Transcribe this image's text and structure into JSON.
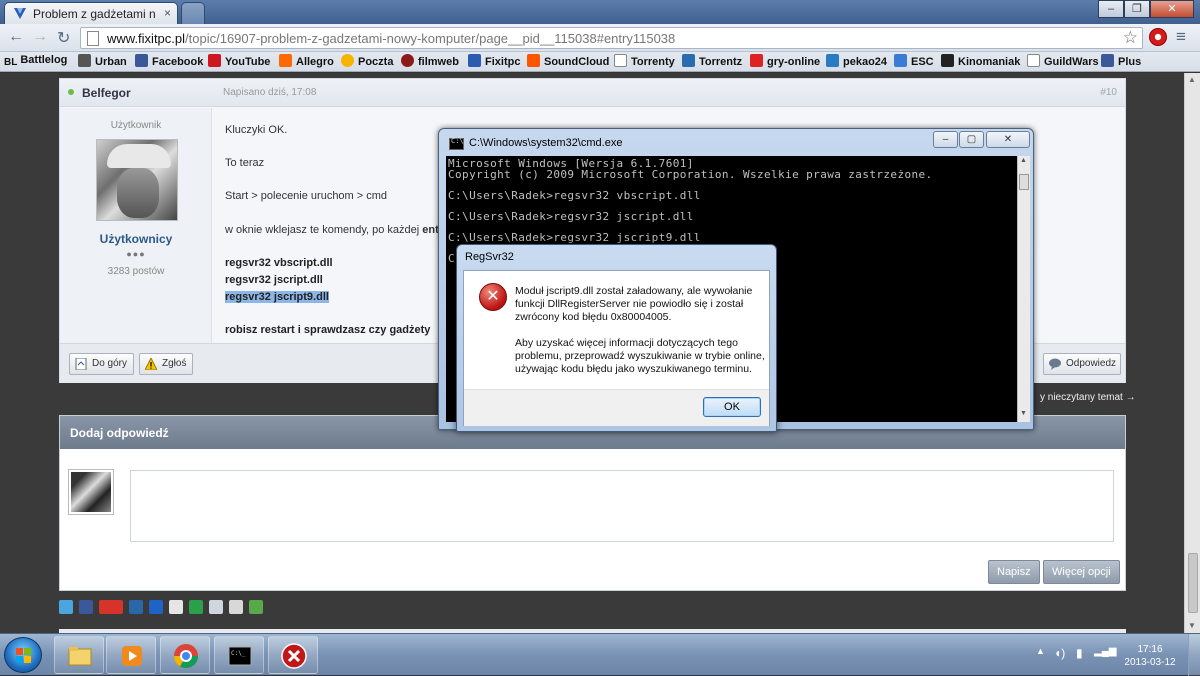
{
  "browser": {
    "tab_title": "Problem z gadżetami nowy komputer",
    "url_host": "www.fixitpc.pl",
    "url_path": "/topic/16907-problem-z-gadzetami-nowy-komputer/page__pid__115038#entry115038",
    "bookmarks": [
      "Battlelog",
      "Urban",
      "Facebook",
      "YouTube",
      "Allegro",
      "Poczta",
      "filmweb",
      "Fixitpc",
      "SoundCloud",
      "Torrenty",
      "Torrentz",
      "gry-online",
      "pekao24",
      "ESC",
      "Kinomaniak",
      "GuildWars",
      "Plus"
    ],
    "bookmark_colors": [
      "#1a1a1a",
      "#3a3a3a",
      "#3b5998",
      "#cc181e",
      "#ff6a00",
      "#f4b400",
      "#8b1a1a",
      "#2a5db0",
      "#ff5500",
      "#ffffff",
      "#2b6cb0",
      "#d22",
      "#2a7bc2",
      "#3a7bd5",
      "#222",
      "#444",
      "#3b5998"
    ]
  },
  "post": {
    "author": "Belfegor",
    "date": "Napisano dziś, 17:08",
    "number": "#10",
    "author_role": "Użytkownik",
    "group": "Użytkownicy",
    "rep": "●●●",
    "post_count": "3283 postów",
    "lines": [
      "Kluczyki OK.",
      "To teraz",
      "Start > polecenie uruchom > cmd",
      "w oknie wklejasz te komendy, po każdej ",
      "ent",
      "regsvr32 vbscript.dll",
      "regsvr32 jscript.dll",
      "regsvr32 jscript9.dll",
      "robisz restart i sprawdzasz czy gadżety"
    ],
    "btn_top": "Do góry",
    "btn_report": "Zgłoś",
    "btn_reply": "Odpowiedz"
  },
  "side_link": "y nieczytany temat →",
  "reply": {
    "title": "Dodaj odpowiedź",
    "btn_post": "Napisz",
    "btn_more": "Więcej opcji"
  },
  "cmd": {
    "title": "C:\\Windows\\system32\\cmd.exe",
    "lines": [
      "Microsoft Windows [Wersja 6.1.7601]",
      "Copyright (c) 2009 Microsoft Corporation. Wszelkie prawa zastrzeżone.",
      "",
      "C:\\Users\\Radek>regsvr32 vbscript.dll",
      "",
      "C:\\Users\\Radek>regsvr32 jscript.dll",
      "",
      "C:\\Users\\Radek>regsvr32 jscript9.dll",
      "",
      "C"
    ]
  },
  "dialog": {
    "title": "RegSvr32",
    "message_1": "Moduł jscript9.dll został załadowany, ale wywołanie funkcji DllRegisterServer nie powiodło się i został zwrócony kod błędu 0x80004005.",
    "message_2": "Aby uzyskać więcej informacji dotyczących tego problemu, przeprowadź wyszukiwanie w trybie online, używając kodu błędu jako wyszukiwanego terminu.",
    "ok_label": "OK"
  },
  "taskbar": {
    "time": "17:16",
    "date": "2013-03-12"
  }
}
